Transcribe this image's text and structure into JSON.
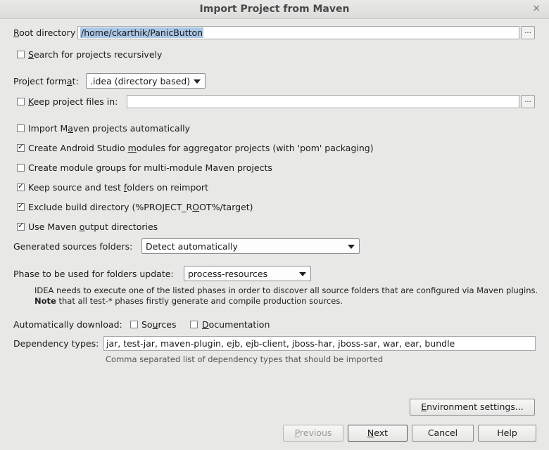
{
  "window": {
    "title": "Import Project from Maven",
    "close_icon": "close-icon"
  },
  "root_directory": {
    "label": "Root directory",
    "value": "/home/ckarthik/PanicButton",
    "browse_label": "..."
  },
  "search_recursively": {
    "label": "Search for projects recursively",
    "checked": false
  },
  "project_format": {
    "label": "Project format:",
    "value": ".idea (directory based)"
  },
  "keep_project_files": {
    "label": "Keep project files in:",
    "checked": false,
    "value": "",
    "browse_label": "..."
  },
  "options": [
    {
      "label": "Import Maven projects automatically",
      "checked": false
    },
    {
      "label": "Create Android Studio modules for aggregator projects (with 'pom' packaging)",
      "checked": true
    },
    {
      "label": "Create module groups for multi-module Maven projects",
      "checked": false
    },
    {
      "label": "Keep source and test folders on reimport",
      "checked": true
    },
    {
      "label": "Exclude build directory (%PROJECT_ROOT%/target)",
      "checked": true
    },
    {
      "label": "Use Maven output directories",
      "checked": true
    }
  ],
  "generated_sources": {
    "label": "Generated sources folders:",
    "value": "Detect automatically"
  },
  "phase": {
    "label": "Phase to be used for folders update:",
    "value": "process-resources",
    "note_line1": "IDEA needs to execute one of the listed phases in order to discover all source folders that are configured via Maven plugins.",
    "note_bold": "Note",
    "note_line2": " that all test-* phases firstly generate and compile production sources."
  },
  "auto_download": {
    "label": "Automatically download:",
    "sources": {
      "label": "Sources",
      "checked": false
    },
    "documentation": {
      "label": "Documentation",
      "checked": false
    }
  },
  "dependency_types": {
    "label": "Dependency types:",
    "value": "jar, test-jar, maven-plugin, ejb, ejb-client, jboss-har, jboss-sar, war, ear, bundle",
    "hint": "Comma separated list of dependency types that should be imported"
  },
  "buttons": {
    "environment": "Environment settings...",
    "previous": "Previous",
    "next": "Next",
    "cancel": "Cancel",
    "help": "Help"
  }
}
